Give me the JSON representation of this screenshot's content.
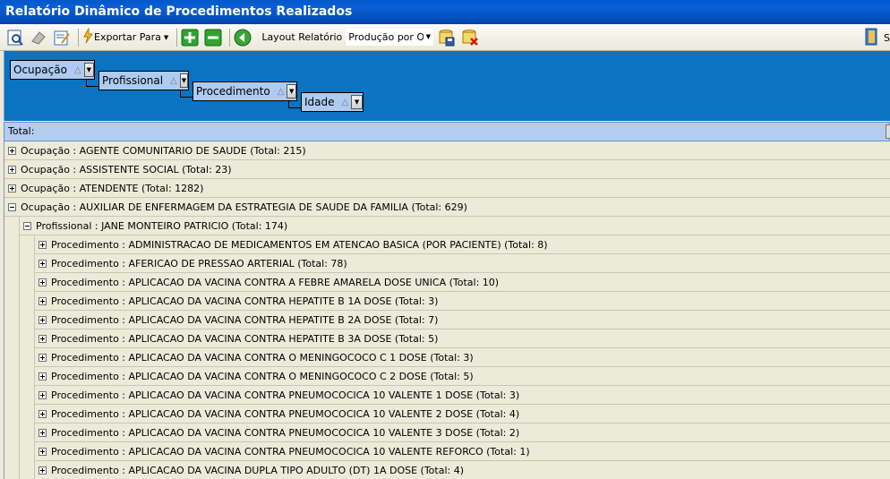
{
  "window": {
    "title": "Relatório Dinâmico de Procedimentos Realizados"
  },
  "toolbar": {
    "export_label": "Exportar Para",
    "layout_label": "Layout Relatório",
    "layout_value": "Produção por Ocu",
    "right_label": "S",
    "icons": [
      "preview-icon",
      "eraser-icon",
      "edit-report-icon",
      "export-icon",
      "expand-all-icon",
      "collapse-all-icon",
      "refresh-icon",
      "save-layout-icon",
      "delete-layout-icon",
      "exit-icon"
    ]
  },
  "group_panel": {
    "chips": [
      {
        "label": "Ocupação"
      },
      {
        "label": "Profissional"
      },
      {
        "label": "Procedimento"
      },
      {
        "label": "Idade"
      }
    ],
    "sort_glyph": "△"
  },
  "grid": {
    "header": "Total:",
    "rows": [
      {
        "level": 0,
        "expanded": false,
        "text": "Ocupação : AGENTE COMUNITARIO DE SAUDE (Total: 215)"
      },
      {
        "level": 0,
        "expanded": false,
        "text": "Ocupação : ASSISTENTE SOCIAL (Total: 23)"
      },
      {
        "level": 0,
        "expanded": false,
        "text": "Ocupação : ATENDENTE (Total: 1282)"
      },
      {
        "level": 0,
        "expanded": true,
        "text": "Ocupação : AUXILIAR DE ENFERMAGEM DA ESTRATEGIA DE SAUDE DA FAMILIA (Total: 629)"
      },
      {
        "level": 1,
        "expanded": true,
        "text": "Profissional : JANE MONTEIRO PATRICIO (Total: 174)"
      },
      {
        "level": 2,
        "expanded": false,
        "text": "Procedimento : ADMINISTRACAO DE MEDICAMENTOS EM ATENCAO BASICA (POR PACIENTE) (Total: 8)"
      },
      {
        "level": 2,
        "expanded": false,
        "text": "Procedimento : AFERICAO DE PRESSAO ARTERIAL (Total: 78)"
      },
      {
        "level": 2,
        "expanded": false,
        "text": "Procedimento : APLICACAO DA VACINA CONTRA A FEBRE AMARELA DOSE UNICA (Total: 10)"
      },
      {
        "level": 2,
        "expanded": false,
        "text": "Procedimento : APLICACAO DA VACINA CONTRA HEPATITE B 1A DOSE (Total: 3)"
      },
      {
        "level": 2,
        "expanded": false,
        "text": "Procedimento : APLICACAO DA VACINA CONTRA HEPATITE B 2A DOSE (Total: 7)"
      },
      {
        "level": 2,
        "expanded": false,
        "text": "Procedimento : APLICACAO DA VACINA CONTRA HEPATITE B 3A DOSE (Total: 5)"
      },
      {
        "level": 2,
        "expanded": false,
        "text": "Procedimento : APLICACAO DA VACINA CONTRA O MENINGOCOCO C 1 DOSE (Total: 3)"
      },
      {
        "level": 2,
        "expanded": false,
        "text": "Procedimento : APLICACAO DA VACINA CONTRA O MENINGOCOCO C 2 DOSE (Total: 5)"
      },
      {
        "level": 2,
        "expanded": false,
        "text": "Procedimento : APLICACAO DA VACINA CONTRA PNEUMOCOCICA 10 VALENTE 1 DOSE (Total: 3)"
      },
      {
        "level": 2,
        "expanded": false,
        "text": "Procedimento : APLICACAO DA VACINA CONTRA PNEUMOCOCICA 10 VALENTE 2 DOSE (Total: 4)"
      },
      {
        "level": 2,
        "expanded": false,
        "text": "Procedimento : APLICACAO DA VACINA CONTRA PNEUMOCOCICA 10 VALENTE 3 DOSE (Total: 2)"
      },
      {
        "level": 2,
        "expanded": false,
        "text": "Procedimento : APLICACAO DA VACINA CONTRA PNEUMOCOCICA 10 VALENTE REFORCO (Total: 1)"
      },
      {
        "level": 2,
        "expanded": false,
        "text": "Procedimento : APLICACAO DA VACINA DUPLA TIPO ADULTO (DT) 1A DOSE (Total: 4)"
      }
    ]
  },
  "colors": {
    "title_bar": "#0452c2",
    "group_panel": "#0a73c2",
    "chip": "#aecbf2",
    "header": "#b3cdf1",
    "row": "#ecead8"
  }
}
